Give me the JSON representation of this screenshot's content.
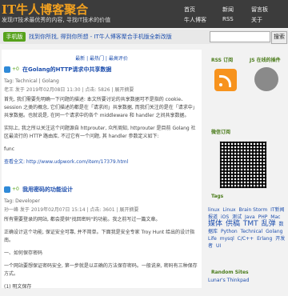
{
  "header": {
    "logo": "IT牛人博客聚合",
    "tagline": "发现IT技术最优秀的内容, 寻找IT技术的价值",
    "nav": {
      "home": "首页",
      "news": "新闻",
      "guestbook": "留言板",
      "wechat": "牛人博客",
      "rss": "RSS",
      "about": "关于"
    }
  },
  "notice_bar": {
    "badge": "手机版",
    "text": "找到你所找, 得到你所想 - IT牛人博客聚合手机版全新改版",
    "search_button": "搜索"
  },
  "tabs": "最新 | 最热门 | 最高评价",
  "posts": [
    {
      "votes": "+0",
      "title": "在Golang的HTTP请求中共享数据",
      "tags": "Tag: Technical | Golang",
      "meta": "老王 发于 2019年02月08日 11:30 | 点击: 5826 | 展开摘要",
      "body": [
        "首先, 我们需要先明确一下问题的描述: 本文所要讨论的共享数据可不是指的 cookie、session 之类的概念, 它们描述的都是在「请求间」共享数据, 而我们关注的是在「请求中」共享数据。也就说是, 在同一个请求中的各个 middleware 和 handler 之间共享数据。",
        "实际上, 我之所以关注这个问题源自 httprouter, 众所周知, httprouter 是目前 Golang 社区最流行的 HTTP 路由库, 不过它有一个问题, 其 handler 参数定义如下:",
        "func",
        "查看全文: http://www.udpwork.com/item/17379.html"
      ]
    },
    {
      "votes": "+0",
      "title": "我用密码的功能设计",
      "tags": "Tag: Developer",
      "meta": "孙一峰 发于 2019年02月07日 15:14 | 点击: 3601 | 展开摘要",
      "body": [
        "所有需要登录的网站, 都会提供\"找回密码\"的功能。我之前写过一篇文章。",
        "正确设计这个功能, 保证安全可靠, 并不简单。下面我是安全专家 Troy Hunt 给出的设计指南。",
        "一、如何保存密码",
        "一个网站要想保证密码安全, 第一步就是以正确的方法保存密码。一般说来, 密码有三种保存方式。",
        "(1) 明文保存"
      ]
    }
  ],
  "side": {
    "rss_title": "RSS 订阅",
    "js_title": "JS 在线的插件",
    "wechat_title": "微信订阅",
    "tags_title": "Tags",
    "tags": [
      [
        "linux",
        false
      ],
      [
        "Linux",
        false
      ],
      [
        "Brain Storm",
        false
      ],
      [
        "IT新闻报道",
        false
      ],
      [
        "iOS",
        false
      ],
      [
        "测试",
        false
      ],
      [
        "Java",
        false
      ],
      [
        "PHP",
        false
      ],
      [
        "Mac",
        false
      ],
      [
        "媒体",
        true
      ],
      [
        "供稿",
        true
      ],
      [
        "TMT",
        true
      ],
      [
        "乱弹",
        true
      ],
      [
        "数据库",
        false
      ],
      [
        "Python",
        false
      ],
      [
        "Technical",
        false
      ],
      [
        "Golang",
        false
      ],
      [
        "Life",
        false
      ],
      [
        "mysql",
        false
      ],
      [
        "C/C++",
        false
      ],
      [
        "Erlang",
        false
      ],
      [
        "开发者",
        false
      ],
      [
        "UI",
        false
      ]
    ],
    "random_title": "Random Sites",
    "random_list": [
      "Lunar's Thinkpad"
    ]
  }
}
